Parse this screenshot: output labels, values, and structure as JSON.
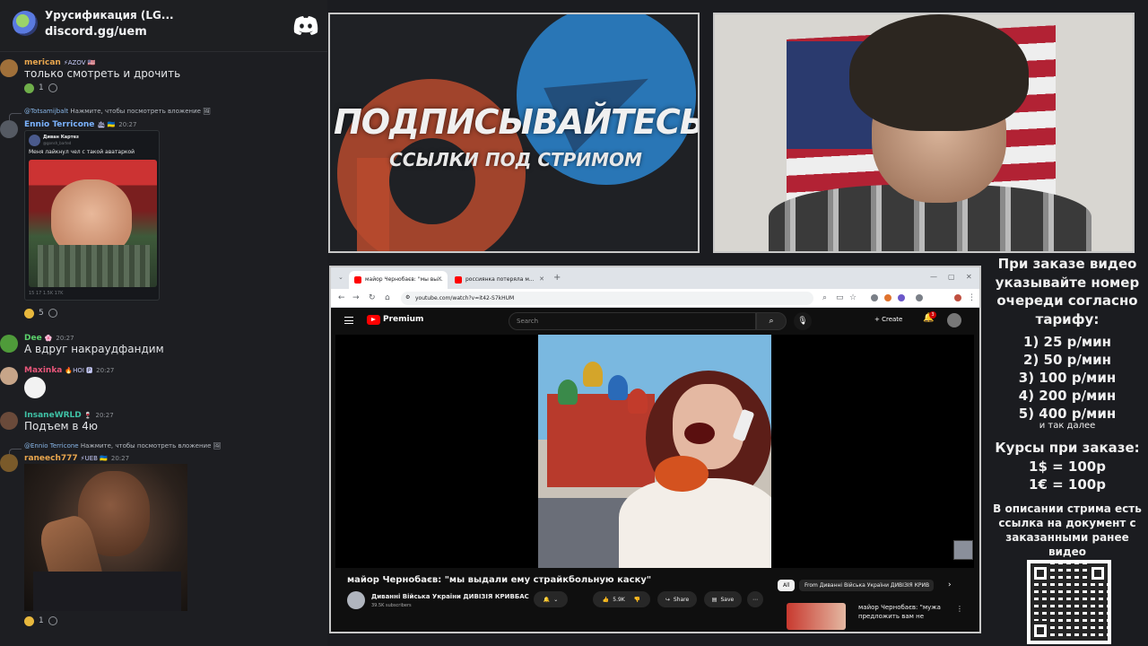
{
  "discord": {
    "server_name": "Урусификация (LG...",
    "invite": "discord.gg/uem",
    "messages": [
      {
        "username": "merican",
        "badge": "⚡AZOV 🇺🇸",
        "time": "",
        "text": "только смотреть и дрочить",
        "reaction_count": "1"
      },
      {
        "reply_to": "@Totsamijbalt",
        "reply_text": "Нажмите, чтобы посмотреть вложение",
        "username": "Ennio Terricone",
        "badge": "🛳 🇺🇦",
        "time": "20:27",
        "tweet": {
          "name": "Диван Картез",
          "handle": "@gonsh_barted",
          "text": "Меня лайкнул чел с такой аватаркой",
          "stats": "15   17   1.5K   17K"
        },
        "reaction_count": "5"
      },
      {
        "username": "Dee",
        "badge": "🌸",
        "time": "20:27",
        "text": "А вдруг накраудфандим"
      },
      {
        "username": "Maxinka",
        "badge": "🔥HOI 🅿",
        "time": "20:27"
      },
      {
        "username": "InsaneWRLD",
        "badge": "🍷",
        "time": "20:27",
        "text": "Подъем в 4ю"
      },
      {
        "reply_to": "@Ennio Terricone",
        "reply_text": "Нажмите, чтобы посмотреть вложение",
        "username": "raneech777",
        "badge": "⚡UEB 🇺🇦",
        "time": "20:27",
        "reaction_count": "1"
      }
    ]
  },
  "promo": {
    "title": "ПОДПИСЫВАЙТЕСЬ",
    "subtitle": "ССЫЛКИ ПОД СТРИМОМ"
  },
  "browser": {
    "tabs": [
      "майор Чернобаєв: \"мы вы...",
      "россиянка потеряла м..."
    ],
    "url": "youtube.com/watch?v=it42-S7kHUM"
  },
  "youtube": {
    "brand": "Premium",
    "search_placeholder": "Search",
    "create_label": "Create",
    "notification_count": "3",
    "video_title": "майор Чернобаєв: \"мы выдали ему страйкбольную каску\"",
    "channel_name": "Диванні Війська України ДИВІЗІЯ КРИВБАС",
    "subscribers": "39.5K subscribers",
    "likes": "5.9K",
    "share_label": "Share",
    "save_label": "Save",
    "chips": {
      "all": "All",
      "from": "From Диванні Війська України ДИВІЗІЯ КРИВ"
    },
    "rec_title": "майор Чернобаєв: \"мужа предложить вам не можем"
  },
  "info": {
    "order_note": "При заказе видео указывайте номер очереди согласно тарифу:",
    "tariffs": [
      "1) 25 р/мин",
      "2) 50 р/мин",
      "3) 100 р/мин",
      "4) 200 р/мин",
      "5) 400 р/мин"
    ],
    "etc": "и так далее",
    "rates_title": "Курсы при заказе:",
    "rates": [
      "1$ = 100р",
      "1€ = 100р"
    ],
    "description_note": "В описании стрима есть ссылка на документ с заказанными ранее видео"
  },
  "colors": {
    "discord_bg": "#1d1e22",
    "youtube_red": "#ff0000",
    "panel_border": "#c8c8c8"
  }
}
